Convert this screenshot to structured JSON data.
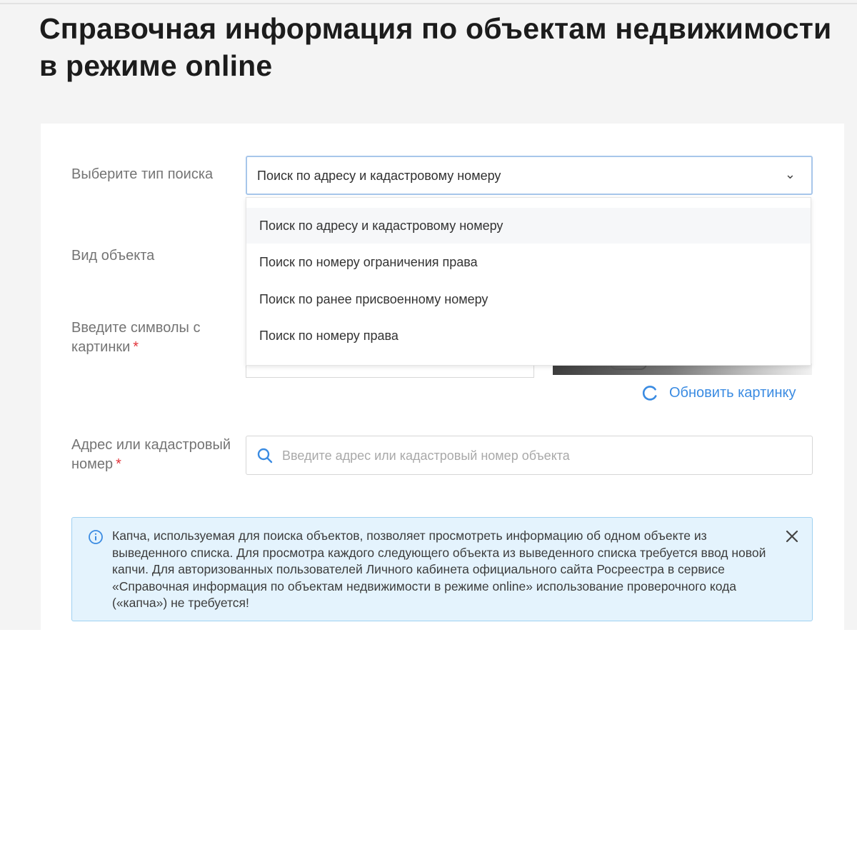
{
  "page": {
    "title": "Справочная информация по объектам недвижимости в режиме online"
  },
  "form": {
    "search_type": {
      "label": "Выберите тип поиска",
      "value": "Поиск по адресу и кадастровому номеру",
      "options": [
        "Поиск по адресу и кадастровому номеру",
        "Поиск по номеру ограничения права",
        "Поиск по ранее присвоенному номеру",
        "Поиск по номеру права"
      ]
    },
    "object_kind": {
      "label": "Вид объекта"
    },
    "captcha": {
      "label": "Введите символы с картинки",
      "required_mark": "*",
      "refresh_label": "Обновить картинку"
    },
    "address": {
      "label": "Адрес или кадастровый номер",
      "required_mark": "*",
      "placeholder": "Введите адрес или кадастровый номер объекта"
    }
  },
  "alert": {
    "text": "Капча, используемая для поиска объектов, позволяет просмотреть информацию об одном объекте из выведенного списка. Для просмотра каждого следующего объекта из выведенного списка требуется ввод новой капчи. Для авторизованных пользователей Личного кабинета официального сайта Росреестра в сервисе «Справочная информация по объектам недвижимости в режиме online» использование проверочного кода («капча») не требуется!"
  },
  "icons": {
    "chevron": "chevron-down-icon",
    "refresh": "refresh-icon",
    "search": "search-icon",
    "info": "info-icon",
    "close": "close-icon"
  },
  "colors": {
    "accent": "#3a8be2",
    "required": "#e2343b",
    "alert_background": "#e4f3fd",
    "alert_border": "#9fd1f1",
    "select_border": "#a7c6ea"
  }
}
